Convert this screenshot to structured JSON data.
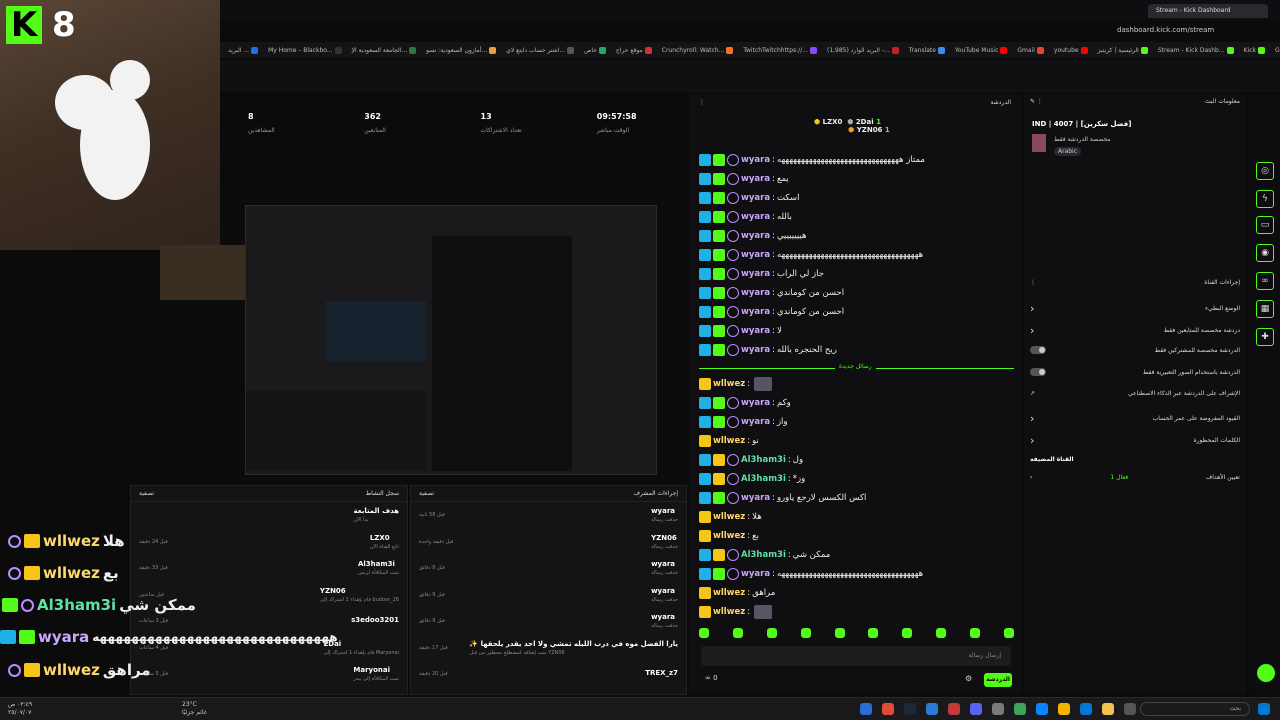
{
  "browser": {
    "tab_title": "Stream - Kick Dashboard",
    "url": "dashboard.kick.com/stream",
    "bookmarks": [
      "البريد ...",
      "My Home – Blackbo...",
      "الجامعة السعودية الإ...",
      "أمازون السعودية: تسو...",
      "اشتر حساب دايتع لاي...",
      "خاص",
      "موقع حراج",
      "Crunchyroll: Watch...",
      "TwitchTwitchhttps://...",
      "(1,985) البريد الوارد -...",
      "Translate",
      "YouTube Music",
      "Gmail",
      "youtube",
      "الرئيسية | كريتيز",
      "Stream - Kick Dashb...",
      "Kick",
      "Google"
    ]
  },
  "webcam": {
    "badge": "8"
  },
  "stats": [
    {
      "value": "8",
      "label": "المشاهدين"
    },
    {
      "value": "362",
      "label": "المتابعين"
    },
    {
      "value": "13",
      "label": "تعداد الاشتراكات"
    },
    {
      "value": "09:57:58",
      "label": "الوقت مباشر"
    }
  ],
  "activity_panel": {
    "title": "سجل النشاط",
    "filter": "تصفية",
    "rows": [
      {
        "name": "هدف المتابعة",
        "sub": "بدأ الآن",
        "time": ""
      },
      {
        "name": "LZX0",
        "sub": "تابع القناة الآن",
        "time": "قبل 24 دقيقة"
      },
      {
        "name": "Al3ham3i",
        "sub": "تمت المكافأة لزيس",
        "time": "قبل 33 دقيقة"
      },
      {
        "name": "YZN06",
        "sub": "قام بإهداء 1 اشتراك إلى budoor_26",
        "time": "قبل ساعتين"
      },
      {
        "name": "s3edoo3201",
        "sub": "",
        "time": "قبل 3 ساعات"
      },
      {
        "name": "2Dai",
        "sub": "قام بإهداء 1 اشتراك إلى Maryonai",
        "time": "قبل 4 ساعات"
      },
      {
        "name": "Maryonai",
        "sub": "تمت المكافأة إلى بيدر",
        "time": "قبل 5 ساعات"
      }
    ]
  },
  "mod_panel": {
    "title": "إجراءات المشرف",
    "filter": "تصفية",
    "rows": [
      {
        "name": "wyara",
        "sub": "حذفت رسالة",
        "time": "قبل 58 ثانية"
      },
      {
        "name": "YZN06",
        "sub": "حذفت رسالة",
        "time": "قبل دقيقة واحدة"
      },
      {
        "name": "wyara",
        "sub": "حذفت رسالة",
        "time": "قبل 8 دقائق"
      },
      {
        "name": "wyara",
        "sub": "حذفت رسالة",
        "time": "قبل 9 دقائق"
      },
      {
        "name": "wyara",
        "sub": "حذفت رسالة",
        "time": "قبل 9 دقائق"
      },
      {
        "name": "✨ يارا الفضل موه في درب الليله تمشي ولا احد يقدر يلحقها",
        "sub": "تمت إضافة كمصطلح محظور من قبل YZN06",
        "time": "قبل 17 دقيقة"
      },
      {
        "name": "TREX_z7",
        "sub": "",
        "time": "قبل 20 دقيقة"
      }
    ]
  },
  "chat": {
    "title": "الدردشة",
    "top_gifters": [
      {
        "name": "LZX0",
        "count": "1"
      },
      {
        "name": "2Dai",
        "count": "1"
      },
      {
        "name": "YZN06",
        "count": "1"
      }
    ],
    "new_messages": "رسائل جديدة",
    "messages": [
      {
        "user": "wyara",
        "text": "ممتاز هههههههههههههههههههههههههههههههه"
      },
      {
        "user": "wyara",
        "text": "يمع"
      },
      {
        "user": "wyara",
        "text": "اسكت"
      },
      {
        "user": "wyara",
        "text": "بالله"
      },
      {
        "user": "wyara",
        "text": "هيييييييي"
      },
      {
        "user": "wyara",
        "text": "ههههههههههههههههههههههههههههههههههههه"
      },
      {
        "user": "wyara",
        "text": "جاز لي الراب"
      },
      {
        "user": "wyara",
        "text": "احسن من كوماندي"
      },
      {
        "user": "wyara",
        "text": "احسن من كوماندي"
      },
      {
        "user": "wyara",
        "text": "لا"
      },
      {
        "user": "wyara",
        "text": "ريح الحنجره بالله"
      },
      {
        "user": "wllwez",
        "text": ""
      },
      {
        "user": "wyara",
        "text": "وكم"
      },
      {
        "user": "wyara",
        "text": "واز"
      },
      {
        "user": "wllwez",
        "text": "نو"
      },
      {
        "user": "Al3ham3i",
        "text": "ول"
      },
      {
        "user": "Al3ham3i",
        "text": "*وز"
      },
      {
        "user": "wyara",
        "text": "اكس الكسس لارجع ياورو"
      },
      {
        "user": "wllwez",
        "text": "هلا"
      },
      {
        "user": "wllwez",
        "text": "بع"
      },
      {
        "user": "Al3ham3i",
        "text": "ممكن شي"
      },
      {
        "user": "wyara",
        "text": "ههههههههههههههههههههههههههههههههههههه"
      },
      {
        "user": "wllwez",
        "text": "مراهق"
      },
      {
        "user": "wllwez",
        "text": ""
      }
    ],
    "input_placeholder": "إرسال رسالة",
    "send": "الدردشة",
    "viewers": "0"
  },
  "stream_info": {
    "title": "معلومات البث",
    "stream_title": "IND | 4007 | [فضل سكرين]",
    "category": "مخصصة الدردشة فقط",
    "language": "Arabic"
  },
  "channel_actions": {
    "title": "إجراءات القناة",
    "items": [
      {
        "label": "الوضع البطيء",
        "type": "chevron"
      },
      {
        "label": "دردشة مخصصة للمتابعين فقط",
        "type": "chevron"
      },
      {
        "label": "الدردشة مخصصة للمشتركين فقط",
        "type": "toggle"
      },
      {
        "label": "الدردشة باستخدام الصور التعبيرية فقط",
        "type": "toggle"
      },
      {
        "label": "الإشراف على الدردشة عبر الذكاء الاصطناعي",
        "type": "link"
      },
      {
        "label": "القيود المفروضة على عمر الحساب",
        "type": "chevron"
      },
      {
        "label": "الكلمات المحظورة",
        "type": "chevron"
      }
    ],
    "subheading": "القناة المضيفة",
    "goals": "تعيين الأهداف",
    "goals_status": "فعال 1"
  },
  "overlay": [
    {
      "user": "wllwez",
      "text": "هلا"
    },
    {
      "user": "wllwez",
      "text": "بع"
    },
    {
      "user": "Al3ham3i",
      "text": "ممكن شي"
    },
    {
      "user": "wyara",
      "text": "ههههههههههههههههههههههههههههههه"
    },
    {
      "user": "wllwez",
      "text": "مراهق"
    }
  ],
  "taskbar": {
    "search": "بحث",
    "weather": "23°C",
    "weather_sub": "غائم جزئيًا",
    "time": "٠٣:٤٩ ص",
    "date": "٢٥/٠٧/٠٧"
  },
  "colors": {
    "kick_green": "#53fc18",
    "bg": "#0f0f11",
    "mod_blue": "#1fb0e6",
    "crown": "#f5c518"
  }
}
